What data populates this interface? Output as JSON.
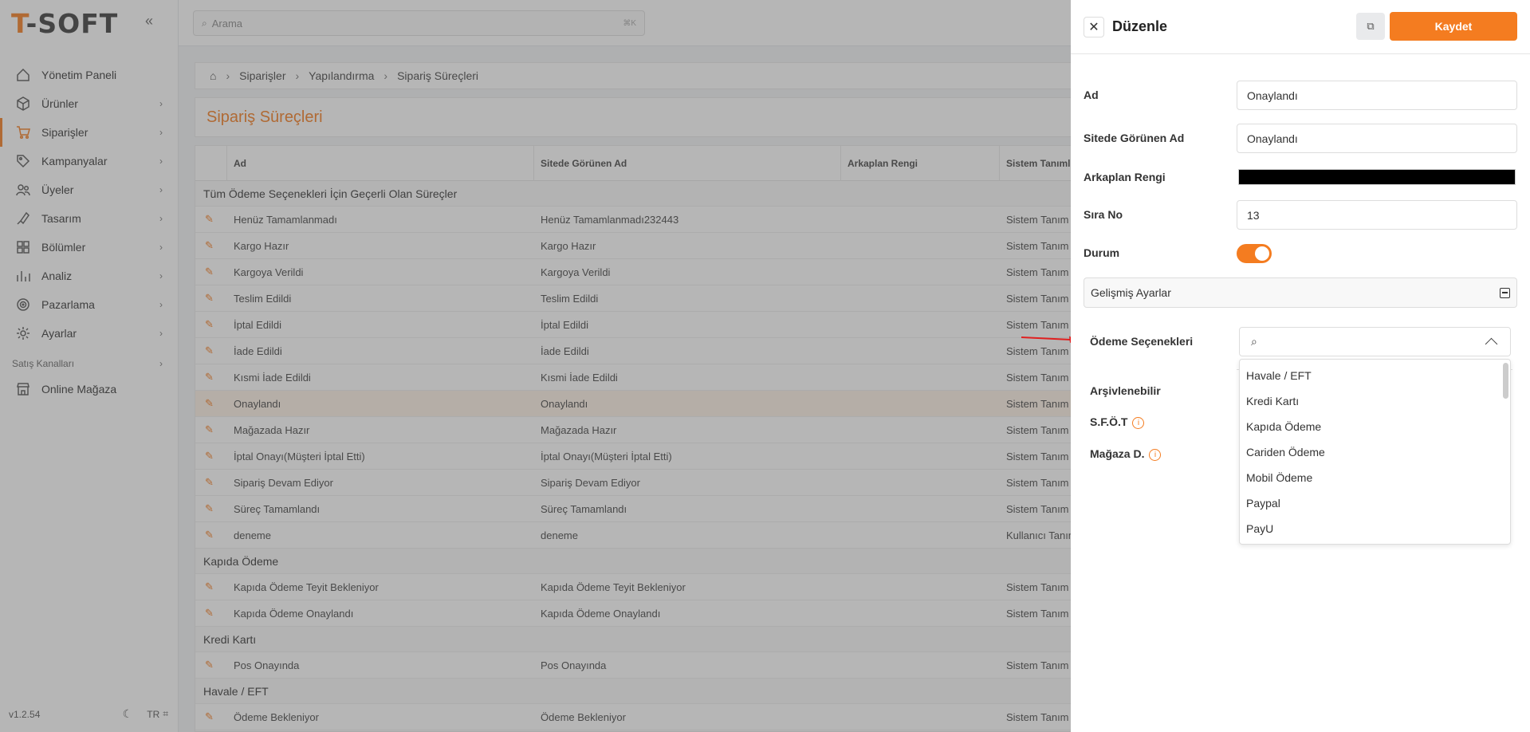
{
  "app": {
    "logo_t": "T",
    "logo_rest": "-SOFT",
    "version": "v1.2.54",
    "lang": "TR"
  },
  "search": {
    "placeholder": "Arama",
    "shortcut": "⌘K"
  },
  "sidebar": {
    "items": [
      {
        "label": "Yönetim Paneli",
        "icon": "home-icon",
        "chevron": false,
        "active": false
      },
      {
        "label": "Ürünler",
        "icon": "box-icon",
        "chevron": true,
        "active": false
      },
      {
        "label": "Siparişler",
        "icon": "cart-icon",
        "chevron": true,
        "active": true
      },
      {
        "label": "Kampanyalar",
        "icon": "tag-icon",
        "chevron": true,
        "active": false
      },
      {
        "label": "Üyeler",
        "icon": "users-icon",
        "chevron": true,
        "active": false
      },
      {
        "label": "Tasarım",
        "icon": "design-icon",
        "chevron": true,
        "active": false
      },
      {
        "label": "Bölümler",
        "icon": "layers-icon",
        "chevron": true,
        "active": false
      },
      {
        "label": "Analiz",
        "icon": "chart-icon",
        "chevron": true,
        "active": false
      },
      {
        "label": "Pazarlama",
        "icon": "target-icon",
        "chevron": true,
        "active": false
      },
      {
        "label": "Ayarlar",
        "icon": "gear-icon",
        "chevron": true,
        "active": false
      }
    ],
    "section_label": "Satış Kanalları",
    "store_label": "Online Mağaza"
  },
  "breadcrumb": [
    "Siparişler",
    "Yapılandırma",
    "Sipariş Süreçleri"
  ],
  "page_title": "Sipariş Süreçleri",
  "table": {
    "headers": [
      "Ad",
      "Sitede Görünen Ad",
      "Arkaplan Rengi",
      "Sistem Tanımlı"
    ],
    "groups": [
      {
        "title": "Tüm Ödeme Seçenekleri İçin Geçerli Olan Süreçler",
        "rows": [
          [
            "Henüz Tamamlanmadı",
            "Henüz Tamamlanmadı232443",
            "",
            "Sistem Tanım"
          ],
          [
            "Kargo Hazır",
            "Kargo Hazır",
            "",
            "Sistem Tanım"
          ],
          [
            "Kargoya Verildi",
            "Kargoya Verildi",
            "",
            "Sistem Tanım"
          ],
          [
            "Teslim Edildi",
            "Teslim Edildi",
            "",
            "Sistem Tanım"
          ],
          [
            "İptal Edildi",
            "İptal Edildi",
            "",
            "Sistem Tanım"
          ],
          [
            "İade Edildi",
            "İade Edildi",
            "",
            "Sistem Tanım"
          ],
          [
            "Kısmi İade Edildi",
            "Kısmi İade Edildi",
            "",
            "Sistem Tanım"
          ],
          [
            "Onaylandı",
            "Onaylandı",
            "",
            "Sistem Tanım"
          ],
          [
            "Mağazada Hazır",
            "Mağazada Hazır",
            "",
            "Sistem Tanım"
          ],
          [
            "İptal Onayı(Müşteri İptal Etti)",
            "İptal Onayı(Müşteri İptal Etti)",
            "",
            "Sistem Tanım"
          ],
          [
            "Sipariş Devam Ediyor",
            "Sipariş Devam Ediyor",
            "",
            "Sistem Tanım"
          ],
          [
            "Süreç Tamamlandı",
            "Süreç Tamamlandı",
            "",
            "Sistem Tanım"
          ],
          [
            "deneme",
            "deneme",
            "",
            "Kullanıcı Tanım"
          ]
        ]
      },
      {
        "title": "Kapıda Ödeme",
        "rows": [
          [
            "Kapıda Ödeme Teyit Bekleniyor",
            "Kapıda Ödeme Teyit Bekleniyor",
            "",
            "Sistem Tanım"
          ],
          [
            "Kapıda Ödeme Onaylandı",
            "Kapıda Ödeme Onaylandı",
            "",
            "Sistem Tanım"
          ]
        ]
      },
      {
        "title": "Kredi Kartı",
        "rows": [
          [
            "Pos Onayında",
            "Pos Onayında",
            "",
            "Sistem Tanım"
          ]
        ]
      },
      {
        "title": "Havale / EFT",
        "rows": [
          [
            "Ödeme Bekleniyor",
            "Ödeme Bekleniyor",
            "",
            "Sistem Tanım"
          ]
        ]
      }
    ],
    "highlight_row": "Onaylandı"
  },
  "drawer": {
    "title": "Düzenle",
    "save_label": "Kaydet",
    "fields": {
      "ad_label": "Ad",
      "ad_value": "Onaylandı",
      "site_label": "Sitede Görünen Ad",
      "site_value": "Onaylandı",
      "bg_label": "Arkaplan Rengi",
      "bg_color": "#000000",
      "sira_label": "Sıra No",
      "sira_value": "13",
      "durum_label": "Durum",
      "durum_on": true
    },
    "advanced_label": "Gelişmiş Ayarlar",
    "payment_label": "Ödeme Seçenekleri",
    "archive_label": "Arşivlenebilir",
    "sfot_label": "S.F.Ö.T",
    "store_label": "Mağaza D.",
    "payment_options": [
      "Havale / EFT",
      "Kredi Kartı",
      "Kapıda Ödeme",
      "Cariden Ödeme",
      "Mobil Ödeme",
      "Paypal",
      "PayU"
    ]
  },
  "colors": {
    "accent": "#f47c20",
    "annotation_arrow": "#e02020"
  }
}
